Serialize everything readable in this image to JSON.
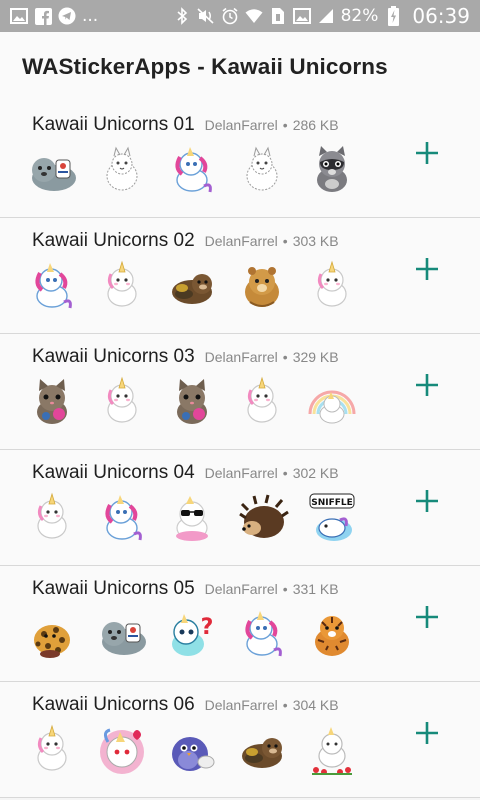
{
  "status_bar": {
    "dots": "...",
    "battery_percent": "82%",
    "time": "06:39"
  },
  "app": {
    "title": "WAStickerApps - Kawaii Unicorns"
  },
  "colors": {
    "accent": "#168a7a"
  },
  "packs": [
    {
      "name": "Kawaii Unicorns 01",
      "author": "DelanFarrel",
      "size": "286 KB",
      "stickers": [
        "seal-sticker",
        "cat-sketch-sticker",
        "unicorn-pink-sticker",
        "unicorn-sketch-sticker",
        "raccoon-sticker"
      ]
    },
    {
      "name": "Kawaii Unicorns 02",
      "author": "DelanFarrel",
      "size": "303 KB",
      "stickers": [
        "unicorn-sticker",
        "unicorn-sticker",
        "otter-sticker",
        "hamster-sticker",
        "unicorn-sticker"
      ]
    },
    {
      "name": "Kawaii Unicorns 03",
      "author": "DelanFarrel",
      "size": "329 KB",
      "stickers": [
        "cat-sticker",
        "unicorn-sticker",
        "cat-sticker",
        "unicorn-sticker",
        "unicorn-rainbow-sticker"
      ]
    },
    {
      "name": "Kawaii Unicorns 04",
      "author": "DelanFarrel",
      "size": "302 KB",
      "stickers": [
        "unicorn-sticker",
        "unicorn-sticker",
        "unicorn-sunglasses-sticker",
        "hedgehog-sticker",
        "unicorn-sniffle-sticker"
      ]
    },
    {
      "name": "Kawaii Unicorns 05",
      "author": "DelanFarrel",
      "size": "331 KB",
      "stickers": [
        "leopard-sticker",
        "seal-sticker",
        "unicorn-question-sticker",
        "unicorn-sticker",
        "tiger-sticker"
      ]
    },
    {
      "name": "Kawaii Unicorns 06",
      "author": "DelanFarrel",
      "size": "304 KB",
      "stickers": [
        "unicorn-sticker",
        "unicorn-heart-sticker",
        "bird-sticker",
        "otter-sticker",
        "unicorn-flowers-sticker"
      ]
    }
  ]
}
